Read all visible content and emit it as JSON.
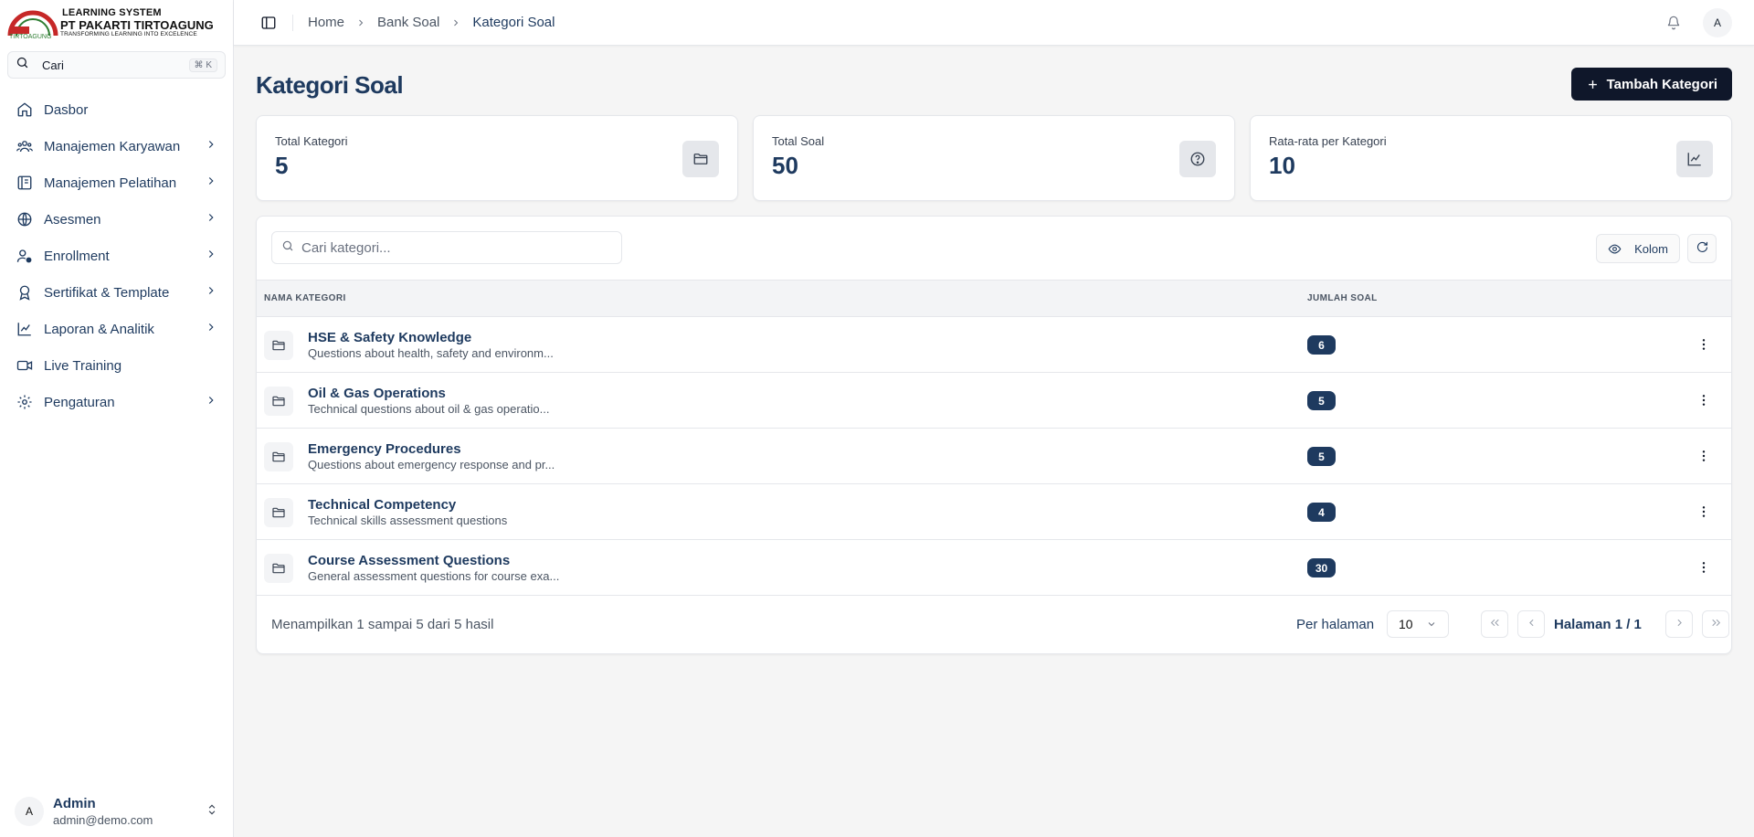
{
  "brand": {
    "line1": "LEARNING SYSTEM",
    "line2": "PT PAKARTI TIRTOAGUNG",
    "line3": "TRANSFORMING LEARNING INTO EXCELENCE",
    "mark_text": "TIRTOAGUNG",
    "colors": {
      "red": "#c62828",
      "green": "#2e7d32"
    }
  },
  "sidebar": {
    "search_placeholder": "Cari",
    "search_shortcut": "⌘ K",
    "items": [
      {
        "label": "Dasbor",
        "icon": "home-icon",
        "has_children": false
      },
      {
        "label": "Manajemen Karyawan",
        "icon": "users-icon",
        "has_children": true
      },
      {
        "label": "Manajemen Pelatihan",
        "icon": "book-icon",
        "has_children": true
      },
      {
        "label": "Asesmen",
        "icon": "globe-icon",
        "has_children": true
      },
      {
        "label": "Enrollment",
        "icon": "user-check-icon",
        "has_children": true
      },
      {
        "label": "Sertifikat & Template",
        "icon": "award-icon",
        "has_children": true
      },
      {
        "label": "Laporan & Analitik",
        "icon": "chart-line-icon",
        "has_children": true
      },
      {
        "label": "Live Training",
        "icon": "video-icon",
        "has_children": false
      },
      {
        "label": "Pengaturan",
        "icon": "gear-icon",
        "has_children": true
      }
    ],
    "user": {
      "initial": "A",
      "name": "Admin",
      "email": "admin@demo.com"
    }
  },
  "topbar": {
    "breadcrumbs": [
      "Home",
      "Bank Soal",
      "Kategori Soal"
    ],
    "avatar_initial": "A"
  },
  "page": {
    "title": "Kategori Soal",
    "add_button": "Tambah Kategori"
  },
  "stats": [
    {
      "label": "Total Kategori",
      "value": "5",
      "icon": "folder-icon"
    },
    {
      "label": "Total Soal",
      "value": "50",
      "icon": "question-circle-icon"
    },
    {
      "label": "Rata-rata per Kategori",
      "value": "10",
      "icon": "chart-line-icon"
    }
  ],
  "table": {
    "search_placeholder": "Cari kategori...",
    "columns_button": "Kolom",
    "headers": {
      "name": "NAMA KATEGORI",
      "count": "JUMLAH SOAL"
    },
    "rows": [
      {
        "title": "HSE & Safety Knowledge",
        "desc": "Questions about health, safety and environm...",
        "count": "6"
      },
      {
        "title": "Oil & Gas Operations",
        "desc": "Technical questions about oil & gas operatio...",
        "count": "5"
      },
      {
        "title": "Emergency Procedures",
        "desc": "Questions about emergency response and pr...",
        "count": "5"
      },
      {
        "title": "Technical Competency",
        "desc": "Technical skills assessment questions",
        "count": "4"
      },
      {
        "title": "Course Assessment Questions",
        "desc": "General assessment questions for course exa...",
        "count": "30"
      }
    ],
    "footer": {
      "info": "Menampilkan 1 sampai 5 dari 5 hasil",
      "per_page_label": "Per halaman",
      "per_page_value": "10",
      "page_label": "Halaman 1 / 1"
    }
  }
}
